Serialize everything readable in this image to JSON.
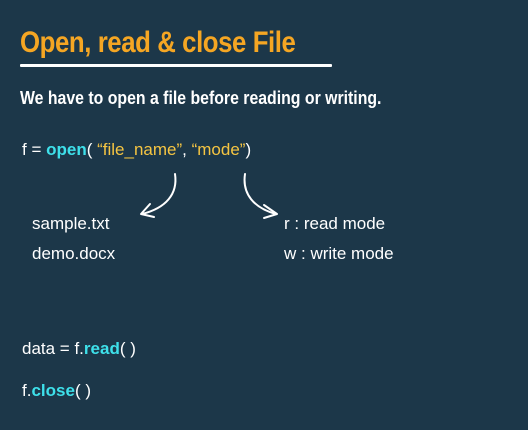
{
  "title": "Open, read & close File",
  "subtitle": "We have to open a file before reading or writing.",
  "colors": {
    "background": "#1c3749",
    "title": "#f5a623",
    "keyword": "#3ee0ea",
    "string": "#f5c542",
    "text": "#ffffff"
  },
  "open_line": {
    "prefix": "f = ",
    "func": "open",
    "paren_open": "( ",
    "arg1": "“file_name”",
    "sep": ", ",
    "arg2": "“mode”",
    "paren_close": ")"
  },
  "file_examples": [
    "sample.txt",
    "demo.docx"
  ],
  "mode_examples": [
    "r : read mode",
    "w : write mode"
  ],
  "read_line": {
    "prefix": "data = f.",
    "func": "read",
    "suffix": "( )"
  },
  "close_line": {
    "prefix": "f.",
    "func": "close",
    "suffix": "( )"
  }
}
